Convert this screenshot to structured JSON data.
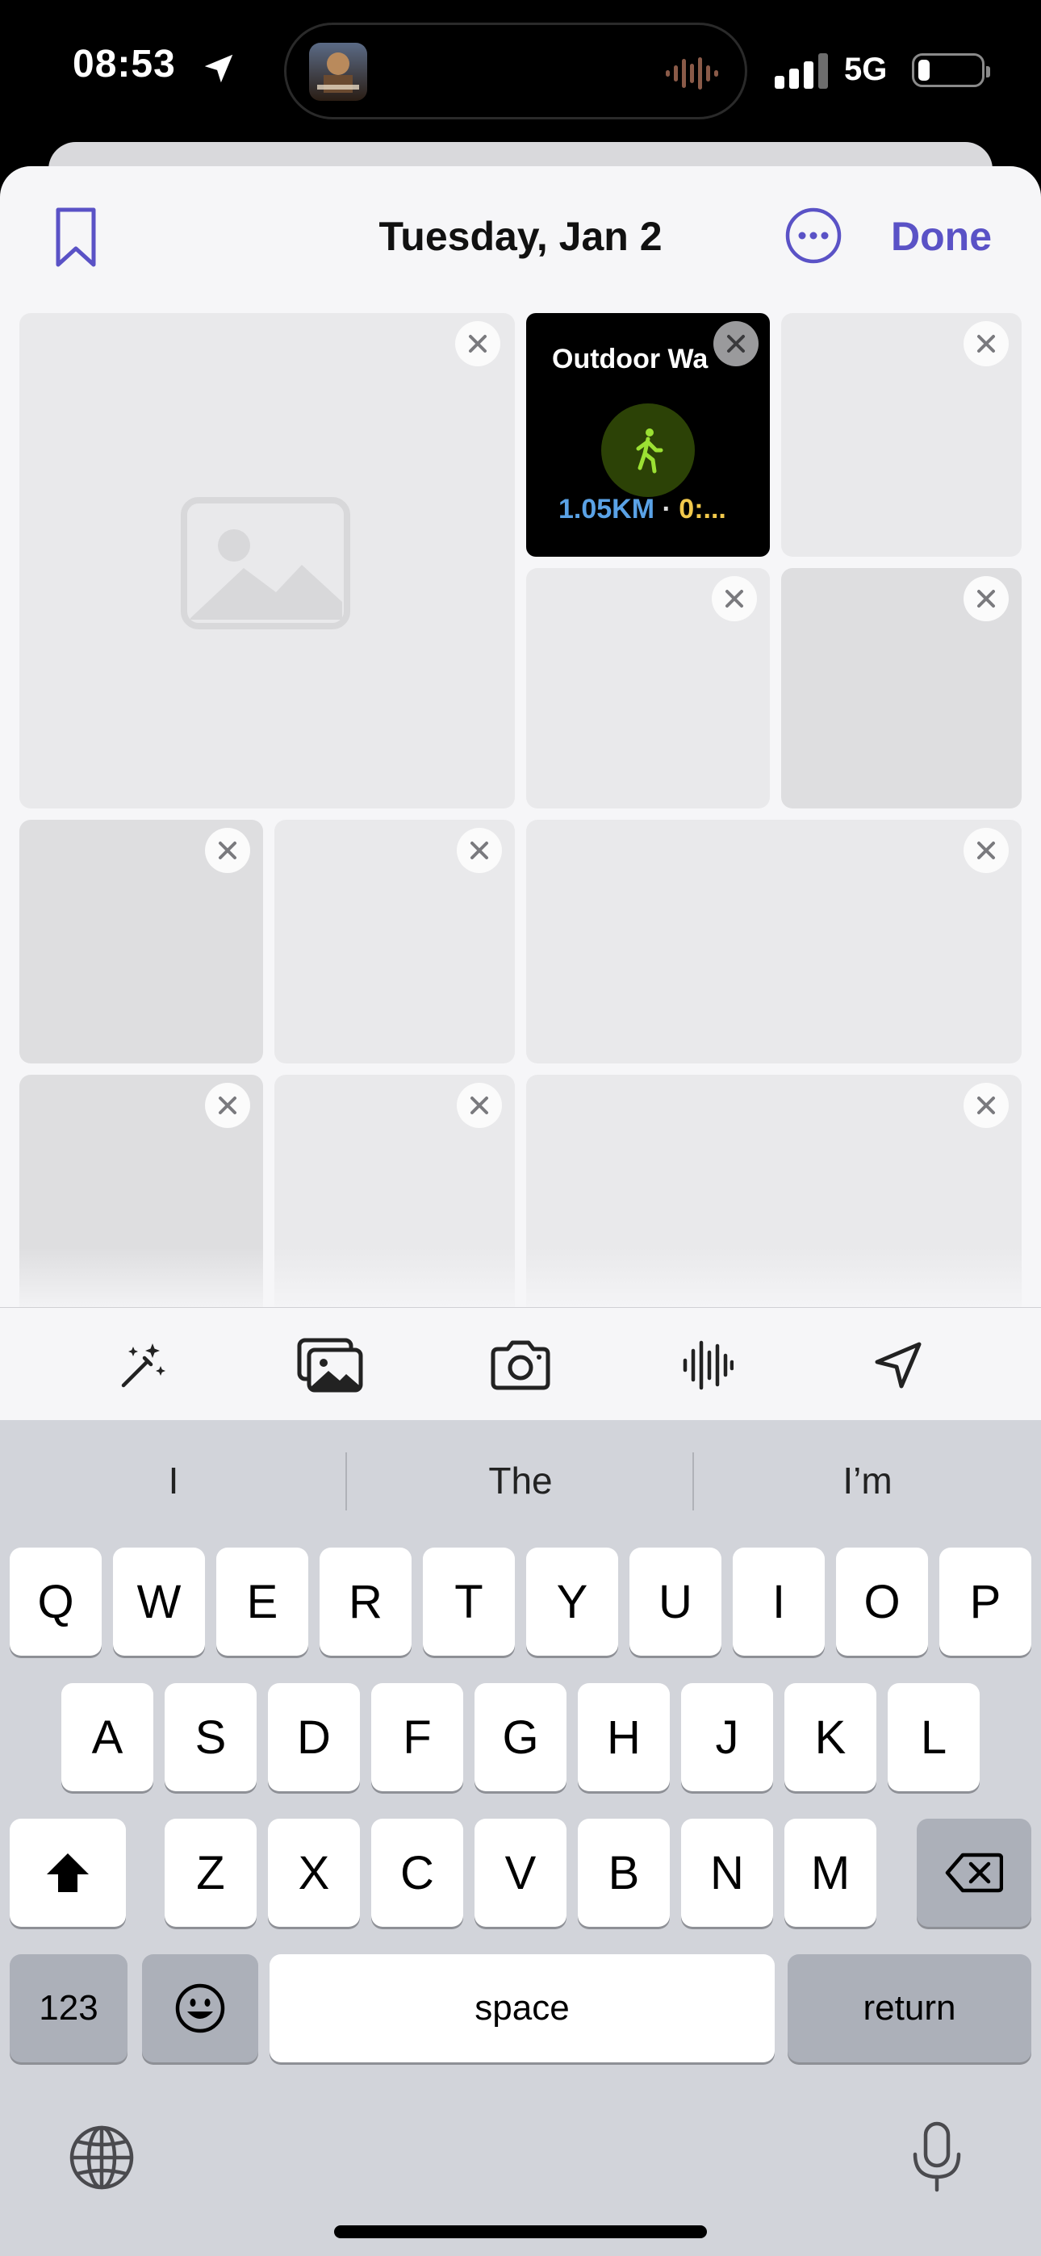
{
  "status_bar": {
    "time": "08:53",
    "network": "5G",
    "icons": [
      "location-arrow-icon",
      "now-playing-artwork",
      "audio-waveform-icon",
      "cellular-signal-icon",
      "battery-icon"
    ]
  },
  "header": {
    "title": "Tuesday, Jan 2",
    "done_label": "Done",
    "icons": [
      "bookmark-icon",
      "more-icon"
    ],
    "accent_color": "#5a52c6"
  },
  "workout_card": {
    "title": "Outdoor Wa",
    "distance": "1.05KM",
    "separator": "·",
    "duration": "0:...",
    "icon": "walking-figure-icon"
  },
  "toolbar": {
    "icons": [
      "magic-wand-icon",
      "photo-library-icon",
      "camera-icon",
      "audio-record-icon",
      "location-icon"
    ]
  },
  "keyboard": {
    "suggestions": [
      "I",
      "The",
      "I’m"
    ],
    "row1": [
      "Q",
      "W",
      "E",
      "R",
      "T",
      "Y",
      "U",
      "I",
      "O",
      "P"
    ],
    "row2": [
      "A",
      "S",
      "D",
      "F",
      "G",
      "H",
      "J",
      "K",
      "L"
    ],
    "row3": [
      "Z",
      "X",
      "C",
      "V",
      "B",
      "N",
      "M"
    ],
    "numbers_label": "123",
    "space_label": "space",
    "return_label": "return"
  }
}
